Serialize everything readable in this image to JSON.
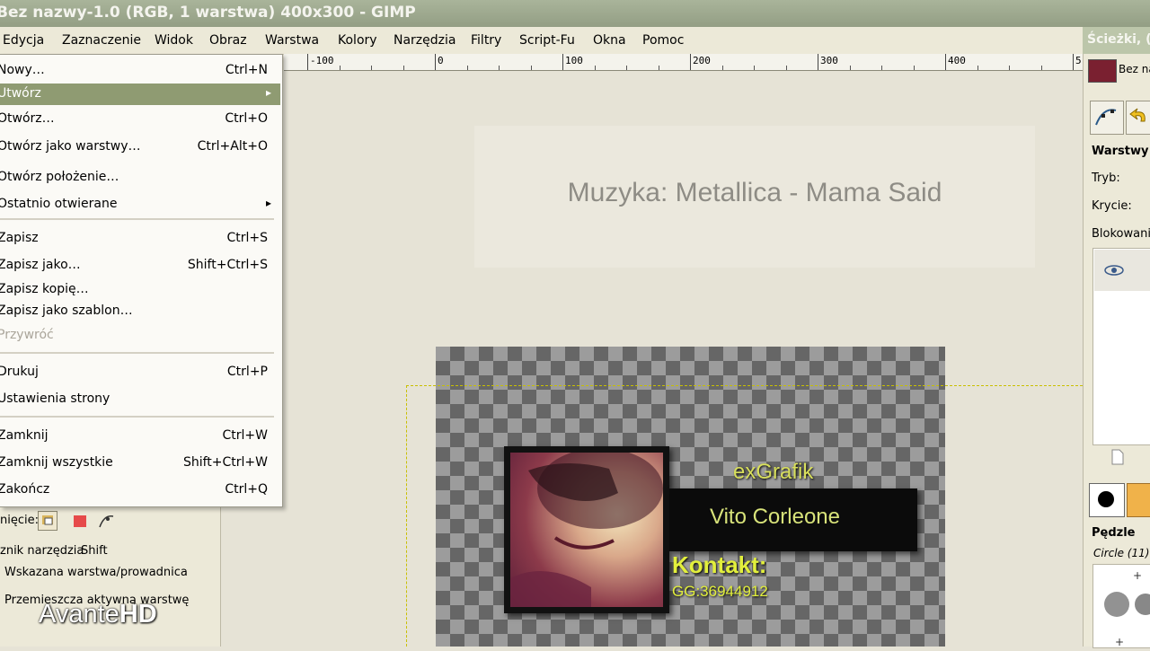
{
  "window": {
    "title": "Bez nazwy-1.0 (RGB, 1 warstwa) 400x300 - GIMP"
  },
  "menubar": [
    {
      "label": "Edycja"
    },
    {
      "label": "Zaznaczenie"
    },
    {
      "label": "Widok"
    },
    {
      "label": "Obraz"
    },
    {
      "label": "Warstwa"
    },
    {
      "label": "Kolory"
    },
    {
      "label": "Narzędzia"
    },
    {
      "label": "Filtry"
    },
    {
      "label": "Script-Fu"
    },
    {
      "label": "Okna"
    },
    {
      "label": "Pomoc"
    }
  ],
  "ruler": {
    "labels": [
      "-100",
      "0",
      "100",
      "200",
      "300",
      "400",
      "5"
    ]
  },
  "file_menu": {
    "items": [
      {
        "label": "Nowy…",
        "shortcut": "Ctrl+N"
      },
      {
        "label": "Utwórz",
        "shortcut": "",
        "submenu": true,
        "highlighted": true
      },
      {
        "label": "Otwórz…",
        "shortcut": "Ctrl+O"
      },
      {
        "label": "Otwórz jako warstwy…",
        "shortcut": "Ctrl+Alt+O"
      },
      {
        "label": "Otwórz położenie…",
        "shortcut": ""
      },
      {
        "label": "Ostatnio otwierane",
        "shortcut": "",
        "submenu": true
      },
      {
        "label": "Zapisz",
        "shortcut": "Ctrl+S"
      },
      {
        "label": "Zapisz jako…",
        "shortcut": "Shift+Ctrl+S"
      },
      {
        "label": "Zapisz kopię…",
        "shortcut": ""
      },
      {
        "label": "Zapisz jako szablon…",
        "shortcut": ""
      },
      {
        "label": "Przywróć",
        "shortcut": "",
        "disabled": true
      },
      {
        "label": "Drukuj",
        "shortcut": "Ctrl+P"
      },
      {
        "label": "Ustawienia strony",
        "shortcut": ""
      },
      {
        "label": "Zamknij",
        "shortcut": "Ctrl+W"
      },
      {
        "label": "Zamknij wszystkie",
        "shortcut": "Shift+Ctrl+W"
      },
      {
        "label": "Zakończ",
        "shortcut": "Ctrl+Q"
      }
    ],
    "submenu_arrow": "▸"
  },
  "overlay": {
    "caption": "Muzyka: Metallica - Mama Said"
  },
  "image": {
    "brand": "exGrafik",
    "name": "Vito Corleone",
    "contact_label": "Kontakt:",
    "contact_value": "GG:36944912"
  },
  "toolbox": {
    "mode_label": "nięcie:",
    "toggle_label": "znik narzędzia",
    "toggle_key": "Shift",
    "option1": "Wskazana warstwa/prowadnica",
    "option2": "Przemieszcza aktywną warstwę"
  },
  "watermark": {
    "text": "Avante",
    "bold": "HD"
  },
  "dock": {
    "title": "Ścieżki, (",
    "image_tab": "Bez na",
    "layers_title": "Warstwy",
    "mode": "Tryb:",
    "opacity": "Krycie:",
    "lock": "Blokowanie",
    "brushes_title": "Pędzle",
    "brush_name": "Circle (11)"
  },
  "colors": {
    "menu_highlight": "#8f9b72",
    "title_bar": "#a9b49a",
    "text_yellow": "#e2ef3c"
  }
}
